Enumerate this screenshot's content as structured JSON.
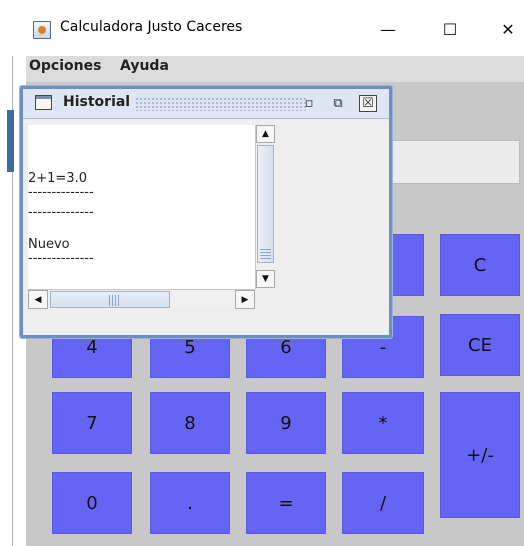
{
  "window": {
    "title": "Calculadora Justo Caceres",
    "minimize_glyph": "—",
    "maximize_glyph": "☐",
    "close_glyph": "✕"
  },
  "menu": [
    "Opciones",
    "Ayuda"
  ],
  "history": {
    "title": "Historial",
    "lines": [
      "2+1=3.0",
      "--------------",
      "--------------",
      "Nuevo",
      "--------------"
    ],
    "iconify_glyph": "▫",
    "maximize_glyph": "⧉",
    "close_glyph": "☒"
  },
  "keys": {
    "c": "C",
    "ce": "CE",
    "four": "4",
    "five": "5",
    "six": "6",
    "minus": "-",
    "seven": "7",
    "eight": "8",
    "nine": "9",
    "multiply": "*",
    "plus_minus": "+/-",
    "zero": "0",
    "dot": ".",
    "equals": "=",
    "divide": "/"
  },
  "scroll_glyphs": {
    "up": "▲",
    "down": "▼",
    "left": "◀",
    "right": "▶"
  },
  "colors": {
    "key_blue": "#6565f5",
    "frame_border": "#6d8fc0",
    "content_gray": "#c8c8c8"
  }
}
